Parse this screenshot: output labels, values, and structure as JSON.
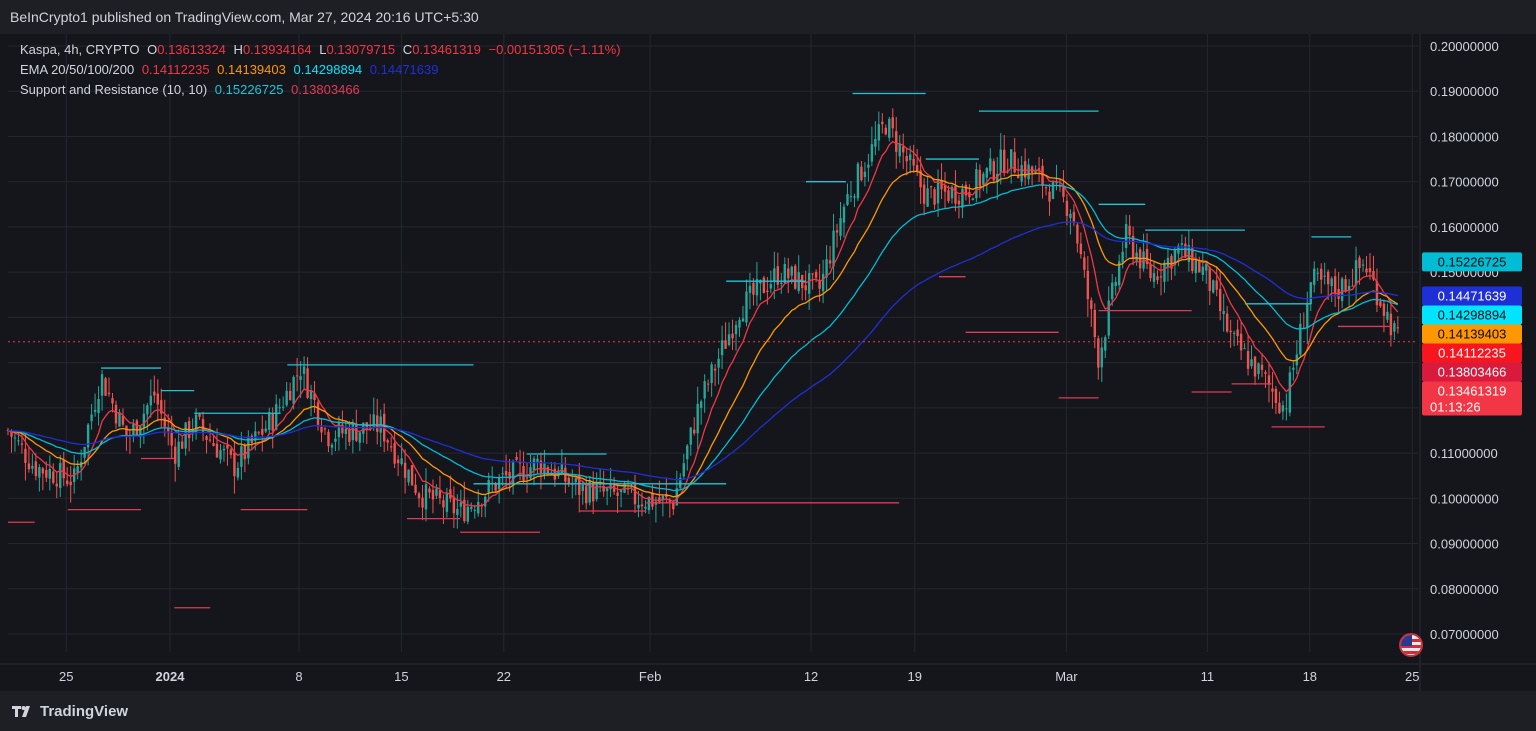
{
  "header": {
    "publish_text": "BeInCrypto1 published on TradingView.com, Mar 27, 2024 20:16 UTC+5:30"
  },
  "footer": {
    "brand": "TradingView"
  },
  "legend": {
    "symbol": {
      "name": "Kaspa, 4h, CRYPTO",
      "o_label": "O",
      "o_value": "0.13613324",
      "h_label": "H",
      "h_value": "0.13934164",
      "l_label": "L",
      "l_value": "0.13079715",
      "c_label": "C",
      "c_value": "0.13461319",
      "change": "−0.00151305 (−1.11%)"
    },
    "ema": {
      "name": "EMA 20/50/100/200",
      "v20": "0.14112235",
      "v50": "0.14139403",
      "v100": "0.14298894",
      "v200": "0.14471639"
    },
    "sr": {
      "name": "Support and Resistance (10, 10)",
      "res": "0.15226725",
      "sup": "0.13803466"
    }
  },
  "chart_data": {
    "type": "candlestick",
    "symbol": "Kaspa",
    "interval": "4h",
    "ylim": [
      0.065,
      0.205
    ],
    "y_ticks": [
      "0.07000000",
      "0.08000000",
      "0.09000000",
      "0.10000000",
      "0.11000000",
      "0.12000000",
      "0.13000000",
      "0.14000000",
      "0.15000000",
      "0.16000000",
      "0.17000000",
      "0.18000000",
      "0.19000000",
      "0.20000000"
    ],
    "y_tick_values": [
      0.07,
      0.08,
      0.09,
      0.1,
      0.11,
      0.12,
      0.13,
      0.14,
      0.15,
      0.16,
      0.17,
      0.18,
      0.19,
      0.2
    ],
    "x_ticks": [
      {
        "label": "25",
        "t": 0.025
      },
      {
        "label": "2024",
        "t": 0.103,
        "bold": true
      },
      {
        "label": "8",
        "t": 0.2
      },
      {
        "label": "15",
        "t": 0.277
      },
      {
        "label": "22",
        "t": 0.354
      },
      {
        "label": "Feb",
        "t": 0.464
      },
      {
        "label": "12",
        "t": 0.585
      },
      {
        "label": "19",
        "t": 0.663
      },
      {
        "label": "Mar",
        "t": 0.777
      },
      {
        "label": "11",
        "t": 0.883
      },
      {
        "label": "18",
        "t": 0.96
      },
      {
        "label": "25",
        "t": 1.037
      }
    ],
    "close_anchors": [
      [
        0.0,
        0.115
      ],
      [
        0.02,
        0.107
      ],
      [
        0.05,
        0.104
      ],
      [
        0.07,
        0.127
      ],
      [
        0.09,
        0.113
      ],
      [
        0.11,
        0.123
      ],
      [
        0.125,
        0.11
      ],
      [
        0.14,
        0.117
      ],
      [
        0.17,
        0.107
      ],
      [
        0.2,
        0.118
      ],
      [
        0.22,
        0.129
      ],
      [
        0.24,
        0.114
      ],
      [
        0.28,
        0.116
      ],
      [
        0.31,
        0.101
      ],
      [
        0.34,
        0.097
      ],
      [
        0.37,
        0.104
      ],
      [
        0.4,
        0.108
      ],
      [
        0.43,
        0.102
      ],
      [
        0.47,
        0.1
      ],
      [
        0.5,
        0.099
      ],
      [
        0.52,
        0.121
      ],
      [
        0.55,
        0.142
      ],
      [
        0.58,
        0.15
      ],
      [
        0.61,
        0.146
      ],
      [
        0.63,
        0.166
      ],
      [
        0.66,
        0.183
      ],
      [
        0.69,
        0.167
      ],
      [
        0.72,
        0.168
      ],
      [
        0.75,
        0.175
      ],
      [
        0.77,
        0.172
      ],
      [
        0.8,
        0.164
      ],
      [
        0.82,
        0.131
      ],
      [
        0.84,
        0.158
      ],
      [
        0.86,
        0.149
      ],
      [
        0.88,
        0.155
      ],
      [
        0.9,
        0.15
      ],
      [
        0.92,
        0.135
      ],
      [
        0.94,
        0.128
      ],
      [
        0.96,
        0.12
      ],
      [
        0.98,
        0.148
      ],
      [
        1.0,
        0.146
      ],
      [
        1.02,
        0.152
      ],
      [
        1.045,
        0.135
      ]
    ],
    "ema_series": [
      {
        "name": "EMA 20",
        "color": "#f23645",
        "period": 20
      },
      {
        "name": "EMA 50",
        "color": "#ff9800",
        "period": 50
      },
      {
        "name": "EMA 100",
        "color": "#00bcd4",
        "period": 100
      },
      {
        "name": "EMA 200",
        "color": "#1f2fd6",
        "period": 200
      }
    ],
    "resistance_levels": [
      {
        "t0": 0.07,
        "t1": 0.115,
        "y": 0.1288
      },
      {
        "t0": 0.115,
        "t1": 0.14,
        "y": 0.1238
      },
      {
        "t0": 0.14,
        "t1": 0.205,
        "y": 0.1188
      },
      {
        "t0": 0.21,
        "t1": 0.35,
        "y": 0.1295
      },
      {
        "t0": 0.39,
        "t1": 0.45,
        "y": 0.1098
      },
      {
        "t0": 0.35,
        "t1": 0.54,
        "y": 0.1032
      },
      {
        "t0": 0.54,
        "t1": 0.6,
        "y": 0.148
      },
      {
        "t0": 0.6,
        "t1": 0.63,
        "y": 0.17
      },
      {
        "t0": 0.635,
        "t1": 0.69,
        "y": 0.1895
      },
      {
        "t0": 0.69,
        "t1": 0.73,
        "y": 0.175
      },
      {
        "t0": 0.73,
        "t1": 0.82,
        "y": 0.1856
      },
      {
        "t0": 0.82,
        "t1": 0.855,
        "y": 0.165
      },
      {
        "t0": 0.855,
        "t1": 0.93,
        "y": 0.1593
      },
      {
        "t0": 0.93,
        "t1": 0.98,
        "y": 0.143
      },
      {
        "t0": 0.98,
        "t1": 1.01,
        "y": 0.1578
      }
    ],
    "support_levels": [
      {
        "t0": 0.0,
        "t1": 0.02,
        "y": 0.0947
      },
      {
        "t0": 0.045,
        "t1": 0.1,
        "y": 0.0975
      },
      {
        "t0": 0.1,
        "t1": 0.125,
        "y": 0.1088
      },
      {
        "t0": 0.125,
        "t1": 0.152,
        "y": 0.0758
      },
      {
        "t0": 0.175,
        "t1": 0.225,
        "y": 0.0975
      },
      {
        "t0": 0.3,
        "t1": 0.34,
        "y": 0.0955
      },
      {
        "t0": 0.34,
        "t1": 0.4,
        "y": 0.0925
      },
      {
        "t0": 0.43,
        "t1": 0.48,
        "y": 0.0972
      },
      {
        "t0": 0.48,
        "t1": 0.67,
        "y": 0.099
      },
      {
        "t0": 0.7,
        "t1": 0.72,
        "y": 0.149
      },
      {
        "t0": 0.72,
        "t1": 0.79,
        "y": 0.1367
      },
      {
        "t0": 0.79,
        "t1": 0.82,
        "y": 0.1222
      },
      {
        "t0": 0.82,
        "t1": 0.89,
        "y": 0.1415
      },
      {
        "t0": 0.89,
        "t1": 0.92,
        "y": 0.1235
      },
      {
        "t0": 0.92,
        "t1": 0.95,
        "y": 0.1253
      },
      {
        "t0": 0.95,
        "t1": 0.99,
        "y": 0.1158
      },
      {
        "t0": 1.0,
        "t1": 1.04,
        "y": 0.138
      }
    ],
    "price_tags": [
      {
        "value": "0.15226725",
        "price": 0.15226725,
        "bg": "#00bcd4",
        "fg": "#0b0b0b"
      },
      {
        "value": "0.14471639",
        "price": 0.14471639,
        "bg": "#1f2fd6",
        "fg": "#ffffff"
      },
      {
        "value": "0.14298894",
        "price": 0.14298894,
        "bg": "#00e5ff",
        "fg": "#0b0b0b"
      },
      {
        "value": "0.14139403",
        "price": 0.14139403,
        "bg": "#ff9800",
        "fg": "#0b0b0b"
      },
      {
        "value": "0.14112235",
        "price": 0.14112235,
        "bg": "#f7161e",
        "fg": "#ffffff"
      },
      {
        "value": "0.13803466",
        "price": 0.13803466,
        "bg": "#d81b3c",
        "fg": "#ffffff"
      },
      {
        "value": "0.13461319",
        "price": 0.13461319,
        "bg": "#f23645",
        "fg": "#ffffff",
        "sub": "01:13:26"
      }
    ],
    "last_price": 0.13461319
  },
  "colors": {
    "up": "#26a69a",
    "down": "#ef5350",
    "resistance": "#1fc4d6",
    "support": "#e03a54",
    "grid": "#25272e",
    "axis_text": "#d1d4dc"
  }
}
